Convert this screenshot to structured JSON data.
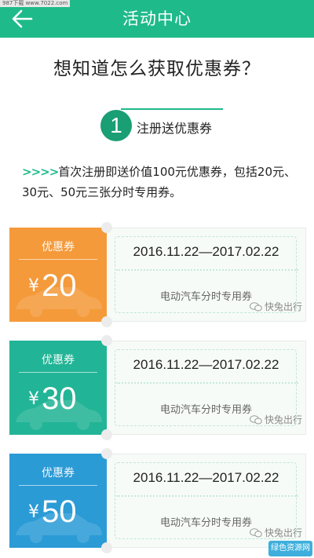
{
  "watermark_top": "987下载 www.7022.com",
  "header": {
    "title": "活动中心",
    "back_icon": "arrow-left-icon",
    "background": "#1fba8a"
  },
  "main": {
    "question": "想知道怎么获取优惠券？",
    "step": {
      "number": "1",
      "label": "注册送优惠券"
    },
    "description_arrows": ">>>>",
    "description": "首次注册即送价值100元优惠券，包括20元、30元、50元三张分时专用券。"
  },
  "coupons": [
    {
      "label": "优惠券",
      "currency": "¥",
      "amount": "20",
      "validity": "2016.11.22—2017.02.22",
      "type": "电动汽车分时专用券",
      "brand": "快兔出行",
      "color": "#f49a3a"
    },
    {
      "label": "优惠券",
      "currency": "¥",
      "amount": "30",
      "validity": "2016.11.22—2017.02.22",
      "type": "电动汽车分时专用券",
      "brand": "快兔出行",
      "color": "#22b496"
    },
    {
      "label": "优惠券",
      "currency": "¥",
      "amount": "50",
      "validity": "2016.11.22—2017.02.22",
      "type": "电动汽车分时专用券",
      "brand": "快兔出行",
      "color": "#2b9bd6"
    }
  ],
  "corner_watermark": "绿色资源网"
}
